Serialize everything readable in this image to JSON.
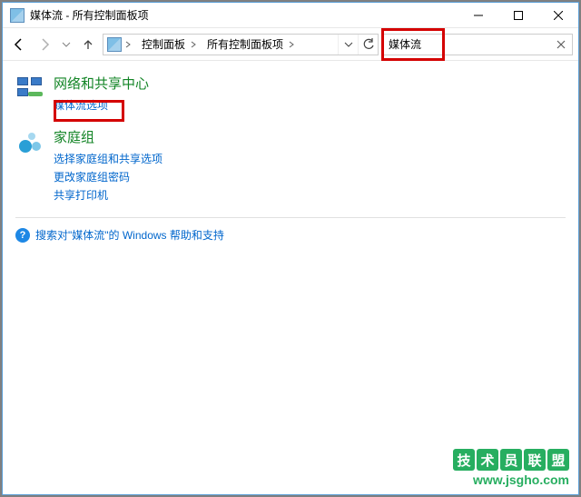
{
  "window": {
    "title": "媒体流 - 所有控制面板项"
  },
  "nav": {
    "breadcrumb": [
      {
        "label": "控制面板"
      },
      {
        "label": "所有控制面板项"
      }
    ],
    "search_value": "媒体流"
  },
  "categories": [
    {
      "icon": "network-icon",
      "title": "网络和共享中心",
      "links": [
        "媒体流选项"
      ]
    },
    {
      "icon": "homegroup-icon",
      "title": "家庭组",
      "links": [
        "选择家庭组和共享选项",
        "更改家庭组密码",
        "共享打印机"
      ]
    }
  ],
  "help": {
    "text": "搜索对\"媒体流\"的 Windows 帮助和支持"
  },
  "watermark": {
    "chars": [
      "技",
      "术",
      "员",
      "联",
      "盟"
    ],
    "url": "www.jsgho.com"
  }
}
